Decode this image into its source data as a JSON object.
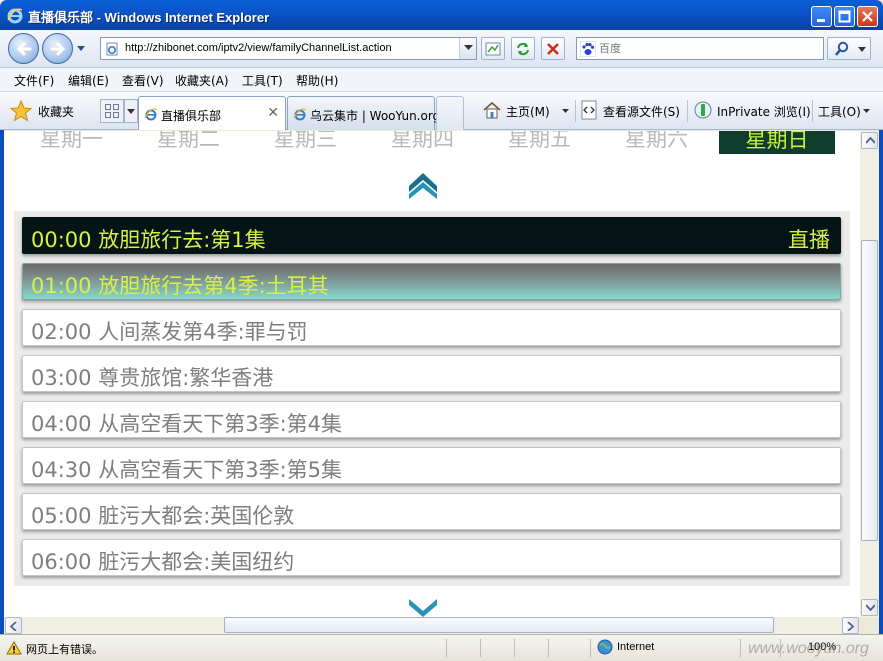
{
  "window": {
    "title": "直播俱乐部 - Windows Internet Explorer"
  },
  "nav": {
    "url": "http://zhibonet.com/iptv2/view/familyChannelList.action",
    "search_placeholder": "百度"
  },
  "menu": {
    "items": [
      "文件(F)",
      "编辑(E)",
      "查看(V)",
      "收藏夹(A)",
      "工具(T)",
      "帮助(H)"
    ]
  },
  "favbar": {
    "favorites_label": "收藏夹",
    "tabs": [
      {
        "label": "直播俱乐部",
        "active": true
      },
      {
        "label": "乌云集市 | WooYun.org",
        "active": false
      }
    ],
    "commands": {
      "home": "主页(M)",
      "view_source": "查看源文件(S)",
      "inprivate": "InPrivate 浏览(I)",
      "tools": "工具(O)"
    }
  },
  "page": {
    "days": [
      "星期一",
      "星期二",
      "星期三",
      "星期四",
      "星期五",
      "星期六",
      "星期日"
    ],
    "selected_day": "星期日",
    "live_badge": "直播",
    "programs": [
      {
        "time": "00:00",
        "title": "放胆旅行去:第1集",
        "state": "live"
      },
      {
        "time": "01:00",
        "title": "放胆旅行去第4季:土耳其",
        "state": "next"
      },
      {
        "time": "02:00",
        "title": "人间蒸发第4季:罪与罚",
        "state": "normal"
      },
      {
        "time": "03:00",
        "title": "尊贵旅馆:繁华香港",
        "state": "normal"
      },
      {
        "time": "04:00",
        "title": "从高空看天下第3季:第4集",
        "state": "normal"
      },
      {
        "time": "04:30",
        "title": "从高空看天下第3季:第5集",
        "state": "normal"
      },
      {
        "time": "05:00",
        "title": "脏污大都会:英国伦敦",
        "state": "normal"
      },
      {
        "time": "06:00",
        "title": "脏污大都会:美国纽约",
        "state": "normal"
      }
    ]
  },
  "status": {
    "message": "网页上有错误。",
    "zone": "Internet",
    "zoom": "100%"
  },
  "watermark": "www.wooyun.org",
  "colors": {
    "title_bar": "#0a55c8",
    "live_bg": "#051414",
    "highlight_text": "#d9f046",
    "selected_day_bg": "#0f3c2c",
    "normal_text": "#7e7e7e"
  }
}
